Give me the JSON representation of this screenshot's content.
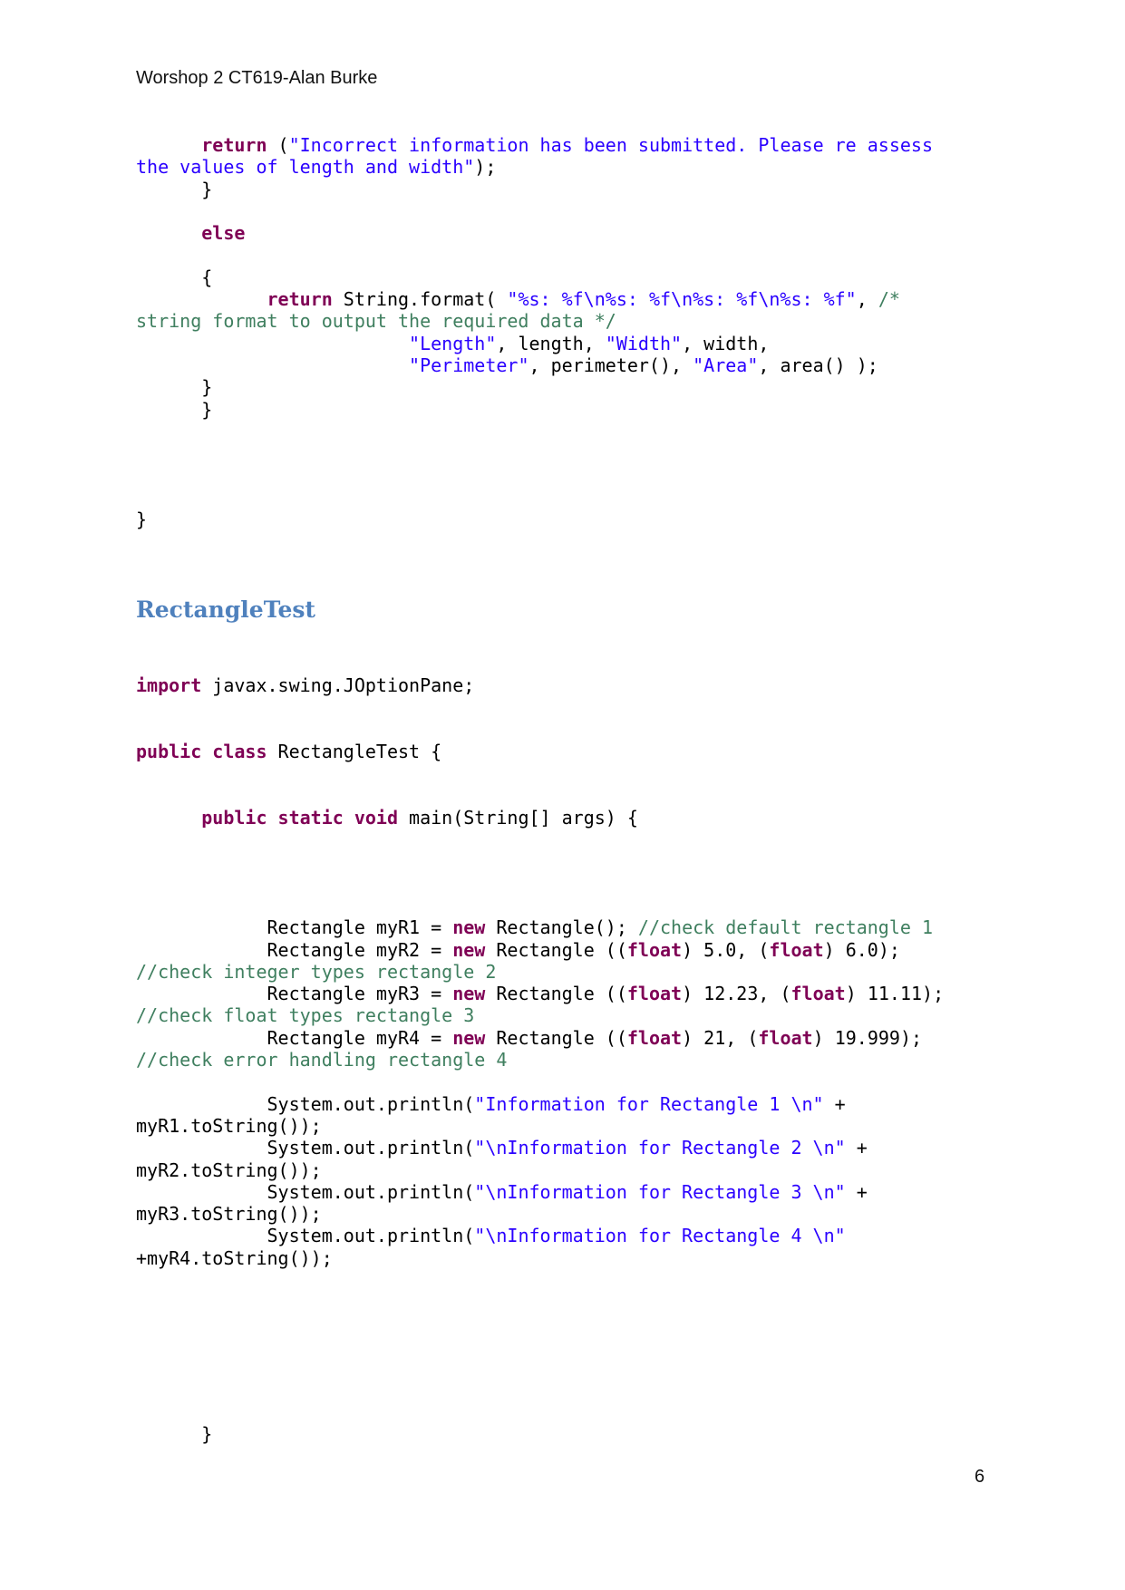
{
  "header": {
    "title": "Worshop 2 CT619-Alan Burke"
  },
  "section": {
    "heading": "RectangleTest"
  },
  "page": {
    "number": "6"
  },
  "code_part1": [
    [
      [
        "      ",
        ""
      ],
      [
        "return",
        "kw"
      ],
      [
        " (",
        ""
      ],
      [
        "\"Incorrect information has been submitted. Please re assess",
        "str"
      ]
    ],
    [
      [
        "the values of length and width\"",
        "str"
      ],
      [
        ");",
        ""
      ]
    ],
    [
      [
        "      }",
        ""
      ]
    ],
    [
      [
        "",
        ""
      ]
    ],
    [
      [
        "      ",
        ""
      ],
      [
        "else",
        "kw"
      ]
    ],
    [
      [
        "",
        ""
      ]
    ],
    [
      [
        "      {",
        ""
      ]
    ],
    [
      [
        "            ",
        ""
      ],
      [
        "return",
        "kw"
      ],
      [
        " String.format( ",
        ""
      ],
      [
        "\"%s: %f\\n%s: %f\\n%s: %f\\n%s: %f\"",
        "str"
      ],
      [
        ", ",
        ""
      ],
      [
        "/*",
        "cm"
      ]
    ],
    [
      [
        "string format to output the required data */",
        "cm"
      ]
    ],
    [
      [
        "                         ",
        ""
      ],
      [
        "\"Length\"",
        "str"
      ],
      [
        ", length, ",
        ""
      ],
      [
        "\"Width\"",
        "str"
      ],
      [
        ", width,",
        ""
      ]
    ],
    [
      [
        "                         ",
        ""
      ],
      [
        "\"Perimeter\"",
        "str"
      ],
      [
        ", perimeter(), ",
        ""
      ],
      [
        "\"Area\"",
        "str"
      ],
      [
        ", area() );",
        ""
      ]
    ],
    [
      [
        "      }",
        ""
      ]
    ],
    [
      [
        "      }",
        ""
      ]
    ],
    [
      [
        "",
        ""
      ]
    ],
    [
      [
        "",
        ""
      ]
    ],
    [
      [
        "",
        ""
      ]
    ],
    [
      [
        "",
        ""
      ]
    ],
    [
      [
        "}",
        ""
      ]
    ]
  ],
  "code_part2": [
    [
      [
        "import",
        "kw"
      ],
      [
        " javax.swing.JOptionPane;",
        ""
      ]
    ],
    [
      [
        "",
        ""
      ]
    ],
    [
      [
        "",
        ""
      ]
    ],
    [
      [
        "public",
        "kw"
      ],
      [
        " ",
        ""
      ],
      [
        "class",
        "kw"
      ],
      [
        " RectangleTest {",
        ""
      ]
    ],
    [
      [
        "",
        ""
      ]
    ],
    [
      [
        "",
        ""
      ]
    ],
    [
      [
        "      ",
        ""
      ],
      [
        "public",
        "kw"
      ],
      [
        " ",
        ""
      ],
      [
        "static",
        "kw"
      ],
      [
        " ",
        ""
      ],
      [
        "void",
        "kw"
      ],
      [
        " main(String[] args) {",
        ""
      ]
    ],
    [
      [
        "",
        ""
      ]
    ],
    [
      [
        "",
        ""
      ]
    ],
    [
      [
        "",
        ""
      ]
    ],
    [
      [
        "",
        ""
      ]
    ],
    [
      [
        "            Rectangle myR1 = ",
        ""
      ],
      [
        "new",
        "kw"
      ],
      [
        " Rectangle(); ",
        ""
      ],
      [
        "//check default rectangle 1",
        "cm"
      ]
    ],
    [
      [
        "            Rectangle myR2 = ",
        ""
      ],
      [
        "new",
        "kw"
      ],
      [
        " Rectangle ((",
        ""
      ],
      [
        "float",
        "kw"
      ],
      [
        ") 5.0, (",
        ""
      ],
      [
        "float",
        "kw"
      ],
      [
        ") 6.0);",
        ""
      ]
    ],
    [
      [
        "//check integer types rectangle 2",
        "cm"
      ]
    ],
    [
      [
        "            Rectangle myR3 = ",
        ""
      ],
      [
        "new",
        "kw"
      ],
      [
        " Rectangle ((",
        ""
      ],
      [
        "float",
        "kw"
      ],
      [
        ") 12.23, (",
        ""
      ],
      [
        "float",
        "kw"
      ],
      [
        ") 11.11);",
        ""
      ]
    ],
    [
      [
        "//check float types rectangle 3",
        "cm"
      ]
    ],
    [
      [
        "            Rectangle myR4 = ",
        ""
      ],
      [
        "new",
        "kw"
      ],
      [
        " Rectangle ((",
        ""
      ],
      [
        "float",
        "kw"
      ],
      [
        ") 21, (",
        ""
      ],
      [
        "float",
        "kw"
      ],
      [
        ") 19.999);",
        ""
      ]
    ],
    [
      [
        "//check error handling rectangle 4",
        "cm"
      ]
    ],
    [
      [
        "",
        ""
      ]
    ],
    [
      [
        "            System.out.println(",
        ""
      ],
      [
        "\"Information for Rectangle 1 \\n\"",
        "str"
      ],
      [
        " +",
        ""
      ]
    ],
    [
      [
        "myR1.toString());",
        ""
      ]
    ],
    [
      [
        "            System.out.println(",
        ""
      ],
      [
        "\"\\nInformation for Rectangle 2 \\n\"",
        "str"
      ],
      [
        " +",
        ""
      ]
    ],
    [
      [
        "myR2.toString());",
        ""
      ]
    ],
    [
      [
        "            System.out.println(",
        ""
      ],
      [
        "\"\\nInformation for Rectangle 3 \\n\"",
        "str"
      ],
      [
        " +",
        ""
      ]
    ],
    [
      [
        "myR3.toString());",
        ""
      ]
    ],
    [
      [
        "            System.out.println(",
        ""
      ],
      [
        "\"\\nInformation for Rectangle 4 \\n\"",
        "str"
      ]
    ],
    [
      [
        "+myR4.toString());",
        ""
      ]
    ],
    [
      [
        "",
        ""
      ]
    ],
    [
      [
        "",
        ""
      ]
    ],
    [
      [
        "",
        ""
      ]
    ],
    [
      [
        "",
        ""
      ]
    ],
    [
      [
        "",
        ""
      ]
    ],
    [
      [
        "",
        ""
      ]
    ],
    [
      [
        "",
        ""
      ]
    ],
    [
      [
        "      }",
        ""
      ]
    ]
  ]
}
